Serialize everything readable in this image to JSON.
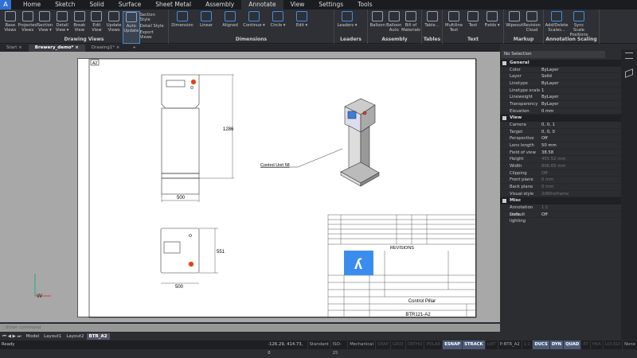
{
  "menu": {
    "logo": "A",
    "tabs": [
      "Home",
      "Sketch",
      "Solid",
      "Surface",
      "Sheet Metal",
      "Assembly",
      "Annotate",
      "View",
      "Settings",
      "Tools"
    ],
    "active": "Annotate"
  },
  "ribbon": {
    "drawing_views": {
      "label": "Drawing Views",
      "buttons": [
        "Base Views",
        "Projected Views",
        "Section View ▾",
        "Detail View ▾",
        "Break View",
        "Edit View",
        "Update Views",
        "Auto Update"
      ],
      "small": [
        "Section Style",
        "Detail Style",
        "Export Views"
      ]
    },
    "dimensions": {
      "label": "Dimensions",
      "buttons": [
        "Dimension",
        "Linear",
        "Aligned",
        "Continue ▾",
        "Circle ▾",
        "Edit ▾"
      ]
    },
    "leaders": {
      "label": "Leaders",
      "buttons": [
        "Leaders ▾"
      ]
    },
    "assembly": {
      "label": "Assembly",
      "buttons": [
        "Balloon",
        "Balloon Auto",
        "Bill of Materials"
      ]
    },
    "tables": {
      "label": "Tables",
      "buttons": [
        "Table..."
      ]
    },
    "text": {
      "label": "Text",
      "buttons": [
        "Multiline Text",
        "Text",
        "Fields ▾"
      ]
    },
    "markup": {
      "label": "Markup",
      "buttons": [
        "Wipeout",
        "Revision Cloud"
      ]
    },
    "annotation_scaling": {
      "label": "Annotation Scaling",
      "buttons": [
        "Add/Delete Scales...",
        "Sync Scale Positions"
      ]
    }
  },
  "doc_tabs": [
    "Start",
    "Brewery_demo*",
    "Drawing1*"
  ],
  "active_doc": "Brewery_demo*",
  "drawing": {
    "sheet_label": "A2",
    "dim_height": "1286",
    "dim_width_front": "500",
    "dim_width_top": "500",
    "dim_depth": "551",
    "leader_label": "Control Unit 58",
    "title_block": {
      "revisions": "REVISIONS",
      "title": "Control Pillar",
      "number": "BTR121-A2"
    }
  },
  "properties": {
    "selection": "No Selection",
    "sections": [
      {
        "name": "General",
        "rows": [
          [
            "Color",
            "ByLayer"
          ],
          [
            "Layer",
            "Solid"
          ],
          [
            "Linetype",
            "ByLayer"
          ],
          [
            "Linetype scale",
            "1"
          ],
          [
            "Lineweight",
            "ByLayer"
          ],
          [
            "Transparency",
            "ByLayer"
          ],
          [
            "Elevation",
            "0 mm"
          ]
        ]
      },
      {
        "name": "View",
        "rows": [
          [
            "Camera",
            "0, 0, 1"
          ],
          [
            "Target",
            "0, 0, 0"
          ],
          [
            "Perspective",
            "Off"
          ],
          [
            "Lens length",
            "50 mm"
          ],
          [
            "Field of view",
            "38.58"
          ],
          [
            "Height",
            "455.52 mm"
          ],
          [
            "Width",
            "806.65 mm"
          ],
          [
            "Clipping",
            "Off"
          ],
          [
            "Front plane",
            "0 mm"
          ],
          [
            "Back plane",
            "0 mm"
          ],
          [
            "Visual style",
            "2dWireframe"
          ]
        ]
      },
      {
        "name": "Misc",
        "rows": [
          [
            "Annotation scale",
            "1:1"
          ],
          [
            "Default lighting",
            "Off"
          ]
        ]
      }
    ]
  },
  "command": {
    "placeholder": ": Enter command"
  },
  "layout_tabs": [
    "Model",
    "Layout1",
    "Layout2",
    "BTR_A2"
  ],
  "status": {
    "ready": "Ready",
    "coords": "-126.29, 414.73, 0",
    "items": [
      [
        "Standard",
        "n"
      ],
      [
        "ISO-25",
        "n"
      ],
      [
        "Mechanical",
        "n"
      ],
      [
        "SNAP",
        "off"
      ],
      [
        "GRID",
        "off"
      ],
      [
        "ORTHO",
        "off"
      ],
      [
        "POLAR",
        "off"
      ],
      [
        "ESNAP",
        "on"
      ],
      [
        "STRACK",
        "on"
      ],
      [
        "LWT",
        "off"
      ],
      [
        "P:BTR_A2",
        "n"
      ],
      [
        "1:1",
        "off"
      ],
      [
        "DUCS",
        "on"
      ],
      [
        "DYN",
        "on"
      ],
      [
        "QUAD",
        "on"
      ],
      [
        "RT",
        "off"
      ],
      [
        "HKA",
        "off"
      ],
      [
        "LOCKUI",
        "off"
      ],
      [
        "None",
        "n"
      ]
    ]
  }
}
